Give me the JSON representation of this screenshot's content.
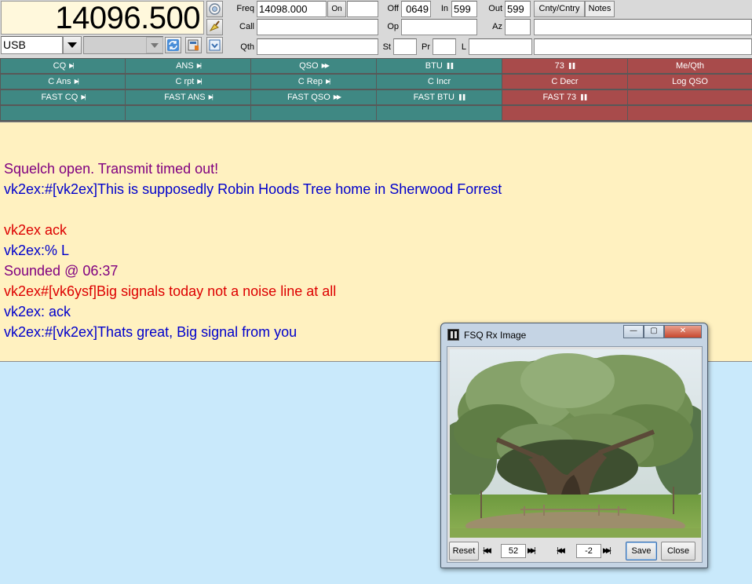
{
  "header": {
    "frequency_display": "14096.500",
    "mode": "USB",
    "freq_label": "Freq",
    "freq_value": "14098.000",
    "on_button": "On",
    "off_label": "Off",
    "off_value": "0649",
    "in_label": "In",
    "in_value": "599",
    "out_label": "Out",
    "out_value": "599",
    "cnty_tab": "Cnty/Cntry",
    "notes_tab": "Notes",
    "call_label": "Call",
    "op_label": "Op",
    "az_label": "Az",
    "qth_label": "Qth",
    "st_label": "St",
    "pr_label": "Pr",
    "l_label": "L"
  },
  "macros": {
    "rows": [
      [
        "CQ",
        "ANS",
        "QSO",
        "BTU",
        "73",
        "Me/Qth"
      ],
      [
        "C Ans",
        "C rpt",
        "C Rep",
        "C Incr",
        "C Decr",
        "Log QSO"
      ],
      [
        "FAST CQ",
        "FAST ANS",
        "FAST QSO",
        "FAST BTU",
        "FAST 73",
        ""
      ],
      [
        "",
        "",
        "",
        "",
        "",
        ""
      ]
    ],
    "colors": {
      "teal": "#3f8883",
      "red": "#a84b4b"
    }
  },
  "rx_lines": [
    {
      "text": "Squelch open.  Transmit timed out!",
      "color": "#800080"
    },
    {
      "text": "vk2ex:#[vk2ex]This is supposedly Robin Hoods Tree home in Sherwood Forrest",
      "color": "#0000cc"
    },
    {
      "text": "",
      "color": "#000000"
    },
    {
      "text": "vk2ex ack",
      "color": "#dd0000"
    },
    {
      "text": "vk2ex:% L",
      "color": "#0000cc"
    },
    {
      "text": "Sounded @ 06:37",
      "color": "#800080"
    },
    {
      "text": "vk2ex#[vk6ysf]Big signals today not a noise line at all",
      "color": "#dd0000"
    },
    {
      "text": "vk2ex: ack",
      "color": "#0000cc"
    },
    {
      "text": "vk2ex:#[vk2ex]Thats great, Big signal from you",
      "color": "#0000cc"
    }
  ],
  "dialog": {
    "title": "FSQ Rx Image",
    "reset": "Reset",
    "value1": "52",
    "value2": "-2",
    "save": "Save",
    "close": "Close"
  }
}
